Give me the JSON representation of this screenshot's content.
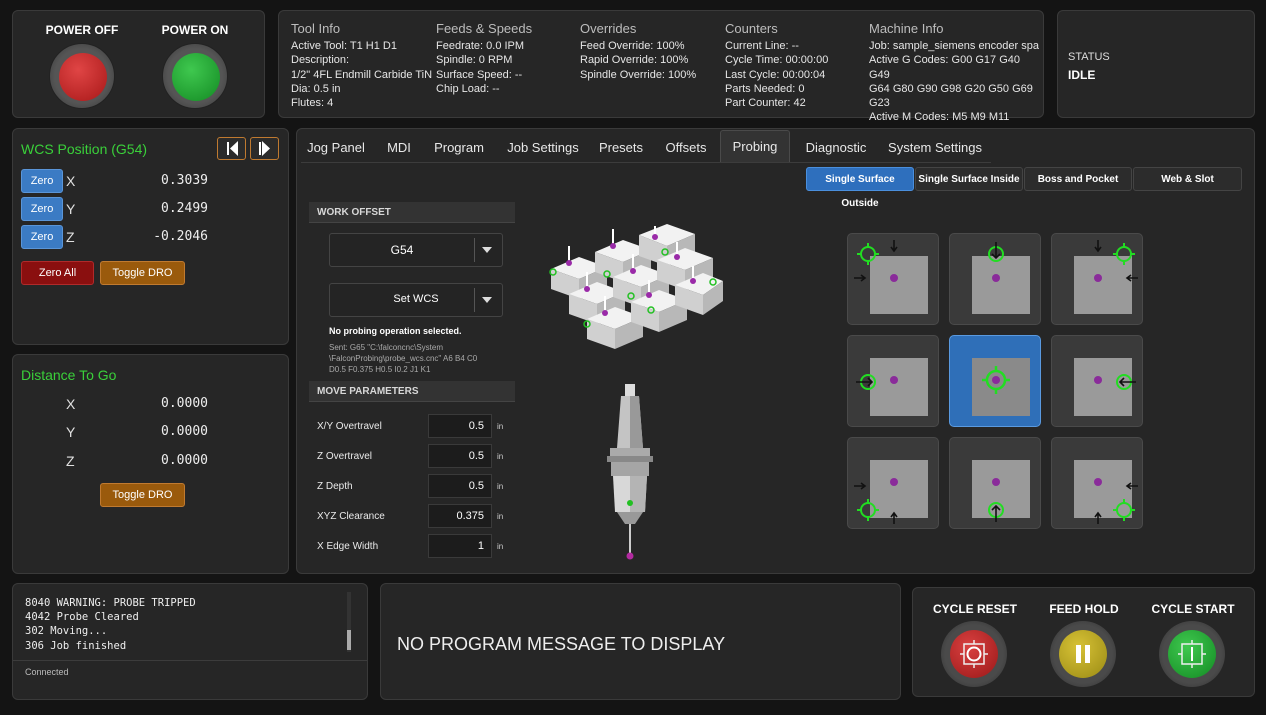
{
  "power": {
    "off_label": "POWER OFF",
    "on_label": "POWER ON"
  },
  "tool_info": {
    "header": "Tool Info",
    "lines": [
      "Active Tool: T1 H1 D1",
      "Description:",
      "1/2\" 4FL Endmill Carbide TiN",
      "Dia: 0.5 in",
      "Flutes: 4"
    ]
  },
  "feeds": {
    "header": "Feeds & Speeds",
    "lines": [
      "Feedrate: 0.0 IPM",
      "Spindle: 0 RPM",
      "Surface Speed: --",
      "Chip Load: --"
    ]
  },
  "overrides": {
    "header": "Overrides",
    "lines": [
      "Feed Override: 100%",
      "Rapid Override: 100%",
      "Spindle Override: 100%"
    ]
  },
  "counters": {
    "header": "Counters",
    "lines": [
      "Current Line: --",
      "Cycle Time: 00:00:00",
      "Last Cycle: 00:00:04",
      "Parts Needed: 0",
      "Part Counter: 42"
    ]
  },
  "machine_info": {
    "header": "Machine Info",
    "lines": [
      "Job: sample_siemens encoder spa...",
      "Active G Codes: G00 G17 G40 G49",
      "G64 G80 G90 G98 G20 G50 G69",
      "G23",
      "Active M Codes: M5 M9 M11"
    ]
  },
  "status": {
    "label": "STATUS",
    "value": "IDLE"
  },
  "wcs": {
    "title": "WCS Position (G54)",
    "zero_label": "Zero",
    "axes": [
      {
        "axis": "X",
        "value": "0.3039"
      },
      {
        "axis": "Y",
        "value": "0.2499"
      },
      {
        "axis": "Z",
        "value": "-0.2046"
      }
    ],
    "zero_all": "Zero All",
    "toggle": "Toggle DRO"
  },
  "dtg": {
    "title": "Distance To Go",
    "axes": [
      {
        "axis": "X",
        "value": "0.0000"
      },
      {
        "axis": "Y",
        "value": "0.0000"
      },
      {
        "axis": "Z",
        "value": "0.0000"
      }
    ],
    "toggle": "Toggle DRO"
  },
  "tabs": [
    "Jog Panel",
    "MDI",
    "Program",
    "Job Settings",
    "Presets",
    "Offsets",
    "Probing",
    "Diagnostic",
    "System Settings"
  ],
  "active_tab": "Probing",
  "subtabs": [
    "Single Surface Outside",
    "Single Surface Inside",
    "Boss and Pocket",
    "Web & Slot"
  ],
  "work_offset": {
    "header": "WORK OFFSET",
    "selected": "G54",
    "set_wcs": "Set WCS",
    "status": "No probing operation selected.",
    "sent_lines": [
      "Sent: G65 \"C:\\falconcnc\\System",
      "\\FalconProbing\\probe_wcs.cnc\" A6 B4 C0",
      "D0.5 F0.375 H0.5 I0.2 J1 K1"
    ]
  },
  "move_params": {
    "header": "MOVE PARAMETERS",
    "fields": [
      {
        "label": "X/Y Overtravel",
        "value": "0.5",
        "unit": "in"
      },
      {
        "label": "Z Overtravel",
        "value": "0.5",
        "unit": "in"
      },
      {
        "label": "Z Depth",
        "value": "0.5",
        "unit": "in"
      },
      {
        "label": "XYZ Clearance",
        "value": "0.375",
        "unit": "in"
      },
      {
        "label": "X Edge Width",
        "value": "1",
        "unit": "in"
      }
    ]
  },
  "console": {
    "lines": [
      "8040 WARNING: PROBE TRIPPED",
      "4042 Probe Cleared",
      "302 Moving...",
      "306 Job finished"
    ],
    "status": "Connected"
  },
  "message": "NO PROGRAM MESSAGE TO DISPLAY",
  "cycle": {
    "reset": "CYCLE RESET",
    "hold": "FEED HOLD",
    "start": "CYCLE START"
  },
  "colors": {
    "accent_blue": "#3b7bc4",
    "green_text": "#3ad03a",
    "zero_all_red": "#8a0f0f",
    "toggle_orange": "#9a5a0c"
  }
}
